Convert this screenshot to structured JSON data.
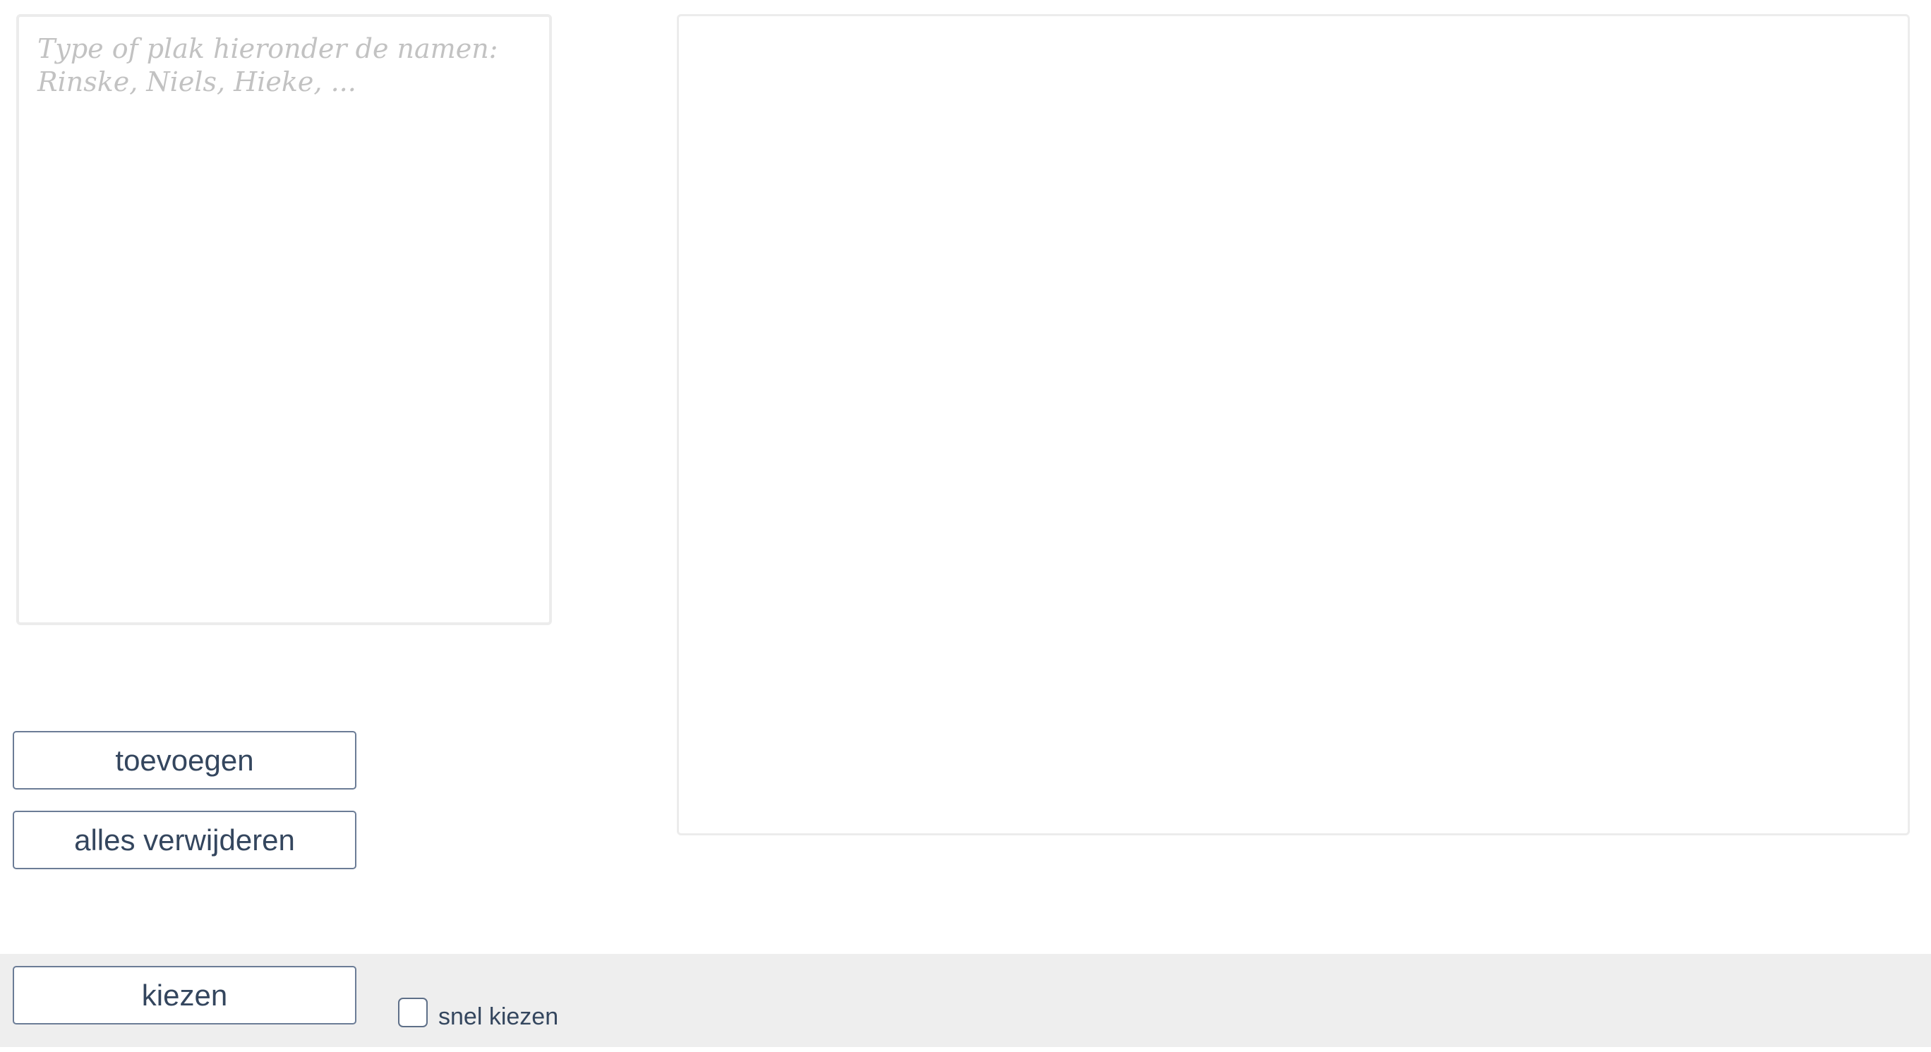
{
  "names_input": {
    "value": "",
    "placeholder": "Type of plak hieronder de namen: Rinske, Niels, Hieke, ..."
  },
  "buttons": {
    "add_label": "toevoegen",
    "clear_label": "alles verwijderen",
    "choose_label": "kiezen"
  },
  "quick_choose": {
    "label": "snel kiezen",
    "checked": false
  },
  "colors": {
    "button_text": "#34465e",
    "button_border": "#6b7c96",
    "bottom_bar": "#eeeeee",
    "panel_border": "#ececec",
    "placeholder": "#c2c2c2"
  }
}
